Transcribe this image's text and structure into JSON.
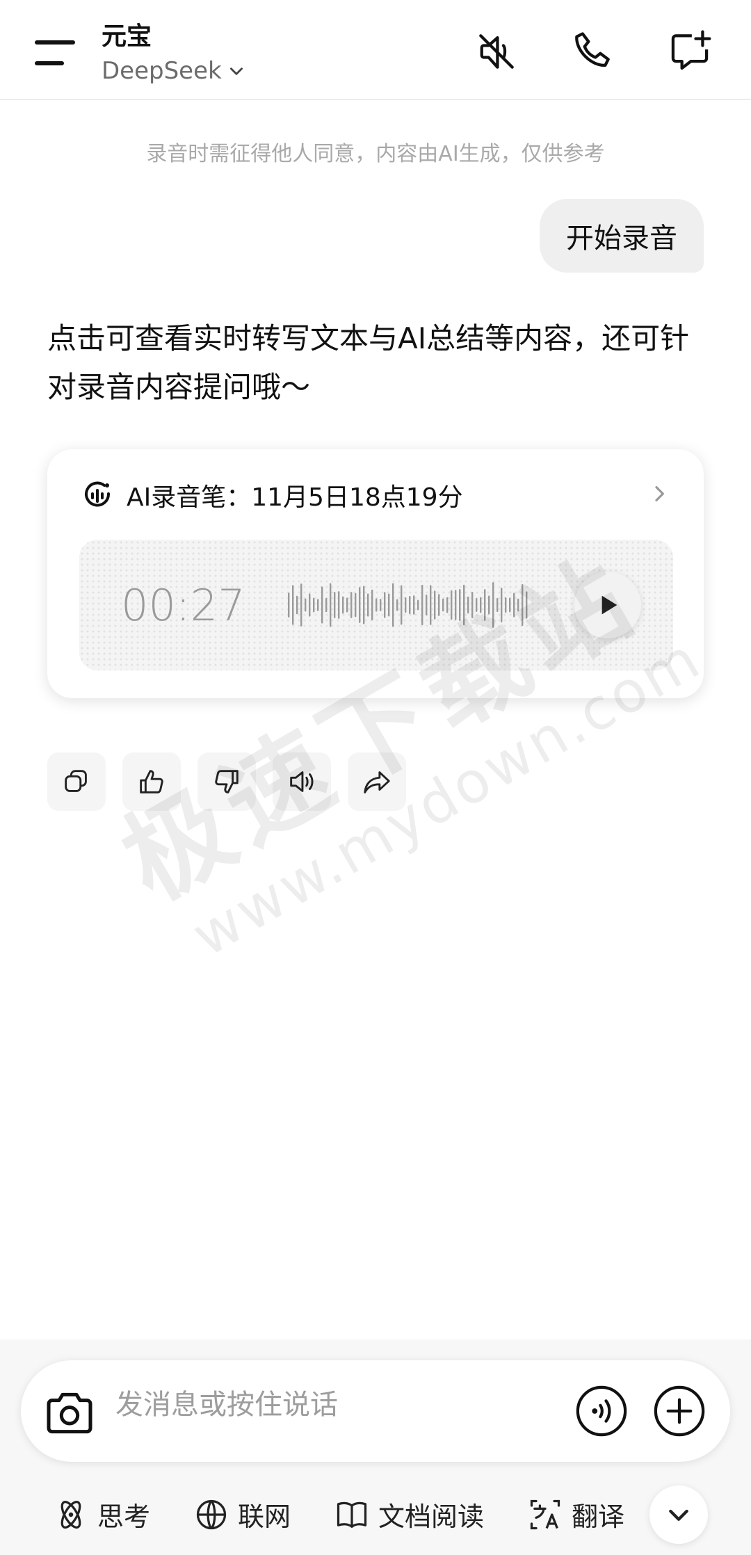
{
  "header": {
    "title": "元宝",
    "model": "DeepSeek",
    "icons": [
      "mute-icon",
      "phone-icon",
      "new-chat-icon"
    ]
  },
  "notice": "录音时需征得他人同意，内容由AI生成，仅供参考",
  "user_message": "开始录音",
  "assistant_message": "点击可查看实时转写文本与AI总结等内容，还可针对录音内容提问哦～",
  "recording_card": {
    "title": "AI录音笔：11月5日18点19分",
    "duration": "00:27"
  },
  "actions": [
    "copy-icon",
    "thumbs-up-icon",
    "thumbs-down-icon",
    "speaker-icon",
    "share-icon"
  ],
  "watermark": {
    "cn": "极速下载站",
    "en": "www.mydown.com"
  },
  "input": {
    "placeholder": "发消息或按住说话"
  },
  "tools": {
    "think": "思考",
    "web": "联网",
    "doc_read": "文档阅读",
    "translate": "翻译"
  },
  "colors": {
    "text": "#111111",
    "muted": "#a9a9a9",
    "bubble": "#efefef"
  }
}
